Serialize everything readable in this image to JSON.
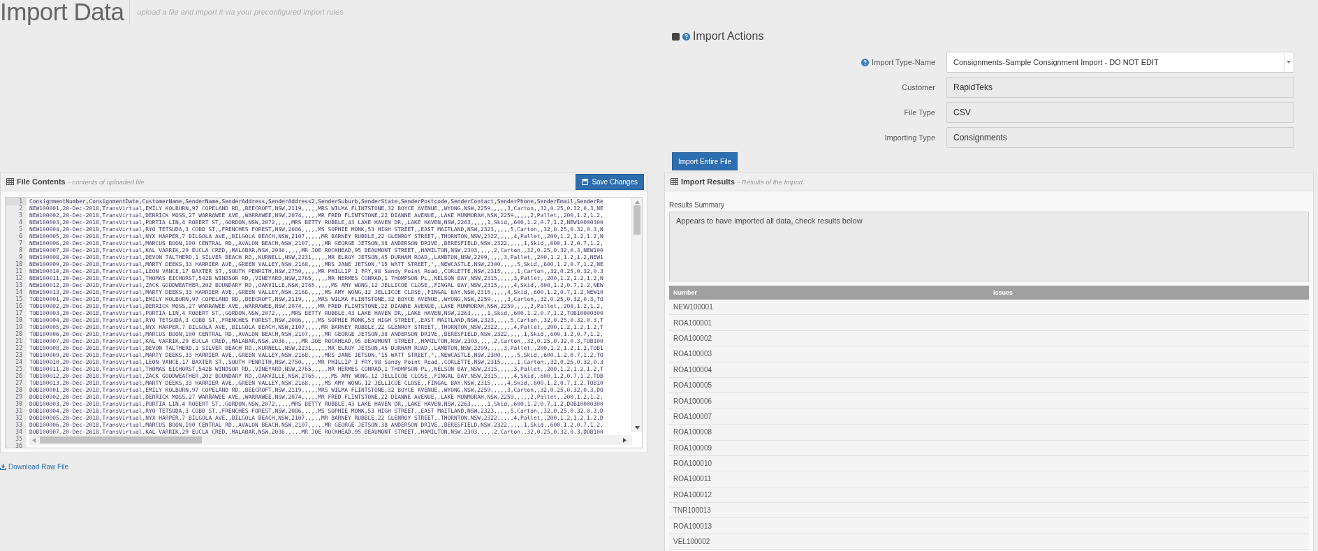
{
  "page": {
    "title": "Import Data",
    "subtitle": "upload a file and import it via your preconfigured import rules"
  },
  "import_actions": {
    "title": "Import Actions",
    "fields": [
      {
        "label": "Import Type-Name",
        "value": "Consignments-Sample Consignment Import - DO NOT EDIT",
        "kind": "select",
        "help": true
      },
      {
        "label": "Customer",
        "value": "RapidTeks",
        "kind": "readonly",
        "help": false
      },
      {
        "label": "File Type",
        "value": "CSV",
        "kind": "readonly",
        "help": false
      },
      {
        "label": "Importing Type",
        "value": "Consignments",
        "kind": "readonly",
        "help": false
      }
    ],
    "button": "Import Entire File"
  },
  "file_contents": {
    "title": "File Contents",
    "subtitle": "- contents of uploaded file",
    "save_button": "Save Changes",
    "lines": [
      {
        "number": "1",
        "text": "ConsignmentNumber,ConsignmentDate,CustomerName,SenderName,SenderAddress,SenderAddress2,SenderSuburb,SenderState,SenderPostcode,SenderContact,SenderPhone,SenderEmail,SenderRe"
      },
      {
        "number": "2",
        "text": "NEW100001,20-Dec-2018,TransVirtual,EMILY KOLBURN,97 COPELAND RD,,BEECROFT,NSW,2119,,,,,MRS WILMA FLINTSTONE,32 BOYCE AVENUE,,WYONG,NSW,2259,,,,,3,Carton,,32,0.25,0.32,0.3,NE"
      },
      {
        "number": "3",
        "text": "NEW100002,20-Dec-2018,TransVirtual,DERRICK MOSS,27 WARRAWEE AVE,,WARRAWEE,NSW,2074,,,,,MR FRED FLINTSTONE,22 DIANNE AVENUE,,LAKE MUNMORAH,NSW,2259,,,,,2,Pallet,,200,1.2,1.2,"
      },
      {
        "number": "4",
        "text": "NEW100003,20-Dec-2018,TransVirtual,PORTIA LIN,4 ROBERT ST,,GORDON,NSW,2072,,,,,MRS BETTY RUBBLE,43 LAKE HAVEN DR,,LAKE HAVEN,NSW,2263,,,,,1,Skid,,600,1.2,0.7,1.2,NEW10000300"
      },
      {
        "number": "5",
        "text": "NEW100004,20-Dec-2018,TransVirtual,RYO TETSUDA,3 COBB ST,,FRENCHES FOREST,NSW,2086,,,,,MS SOPHIE MONK,53 HIGH STREET,,EAST MAITLAND,NSW,2323,,,,,5,Carton,,32,0.25,0.32,0.3,N"
      },
      {
        "number": "6",
        "text": "NEW100005,20-Dec-2018,TransVirtual,NYX HARPER,7 BILGOLA AVE,,BILGOLA BEACH,NSW,2107,,,,,MR BARNEY RUBBLE,22 GLENROY STREET,,THORNTON,NSW,2322,,,,,4,Pallet,,200,1.2,1.2,1.2,N"
      },
      {
        "number": "7",
        "text": "NEW100006,20-Dec-2018,TransVirtual,MARCUS BOON,100 CENTRAL RD,,AVALON BEACH,NSW,2107,,,,,MR GEORGE JETSON,38 ANDERSON DRIVE,,BERESFIELD,NSW,2322,,,,,1,Skid,,600,1.2,0.7,1.2,"
      },
      {
        "number": "8",
        "text": "NEW100007,20-Dec-2018,TransVirtual,KAL VARRIK,29 EUCLA CRED,,MALABAR,NSW,2036,,,,,MR JOE ROCKHEAD,95 BEAUMONT STREET,,HAMILTON,NSW,2303,,,,,2,Carton,,32,0.25,0.32,0.3,NEW100"
      },
      {
        "number": "9",
        "text": "NEW100008,20-Dec-2018,TransVirtual,DEVON TALTHERD,1 SILVER BEACH RD,,KURNELL,NSW,2231,,,,,MR ELROY JETSON,45 DURHAM ROAD,,LAMBTON,NSW,2299,,,,,3,Pallet,,200,1.2,1.2,1.2,NEW1"
      },
      {
        "number": "10",
        "text": "NEW100009,20-Dec-2018,TransVirtual,MARTY DEEKS,33 HARRIER AVE,,GREEN VALLEY,NSW,2168,,,,,MRS JANE JETSON,\"15 WATT STREET,\",,NEWCASTLE,NSW,2300,,,,,5,Skid,,600,1.2,0.7,1.2,NE"
      },
      {
        "number": "11",
        "text": "NEW100010,20-Dec-2018,TransVirtual,LEON VANCE,17 BAXTER ST,,SOUTH PENRITH,NSW,2750,,,,,MR PHILLIP J FRY,98 Sandy Point Road,,CORLETTE,NSW,2315,,,,,1,Carton,,32,0.25,0.32,0.3"
      },
      {
        "number": "12",
        "text": "NEW100011,20-Dec-2018,TransVirtual,THOMAS EICHORST,542B WINDSOR RD,,VINEYARD,NSW,2765,,,,,MR HERMES CONRAD,1 THOMPSON PL,,NELSON BAY,NSW,2315,,,,,3,Pallet,,200,1.2,1.2,1.2,N"
      },
      {
        "number": "13",
        "text": "NEW100012,20-Dec-2018,TransVirtual,ZACK GOODWEATHER,202 BOUNDARY RD,,OAKVILLE,NSW,2765,,,,,MS AMY WONG,12 JELLICOE CLOSE,,FINGAL BAY,NSW,2315,,,,,4,Skid,,600,1.2,0.7,1.2,NEW"
      },
      {
        "number": "14",
        "text": "NEW100013,20-Dec-2018,TransVirtual,MARTY DEEKS,33 HARRIER AVE,,GREEN VALLEY,NSW,2168,,,,,MS AMY WONG,12 JELLICOE CLOSE,,FINGAL BAY,NSW,2315,,,,,4,Skid,,600,1.2,0.7,1.2,NEW10"
      },
      {
        "number": "15",
        "text": "TOB100001,20-Dec-2018,TransVirtual,EMILY KOLBURN,97 COPELAND RD,,BEECROFT,NSW,2119,,,,,MRS WILMA FLINTSTONE,32 BOYCE AVENUE,,WYONG,NSW,2259,,,,,3,Carton,,32,0.25,0.32,0.3,TO"
      },
      {
        "number": "16",
        "text": "TOB100002,20-Dec-2018,TransVirtual,DERRICK MOSS,27 WARRAWEE AVE,,WARRAWEE,NSW,2074,,,,,MR FRED FLINTSTONE,22 DIANNE AVENUE,,LAKE MUNMORAH,NSW,2259,,,,,2,Pallet,,200,1.2,1.2,"
      },
      {
        "number": "17",
        "text": "TOB100003,20-Dec-2018,TransVirtual,PORTIA LIN,4 ROBERT ST,,GORDON,NSW,2072,,,,,MRS BETTY RUBBLE,43 LAKE HAVEN DR,,LAKE HAVEN,NSW,2263,,,,,1,Skid,,600,1.2,0.7,1.2,TOB10000300"
      },
      {
        "number": "18",
        "text": "TOB100004,20-Dec-2018,TransVirtual,RYO TETSUDA,3 COBB ST,,FRENCHES FOREST,NSW,2086,,,,,MS SOPHIE MONK,53 HIGH STREET,,EAST MAITLAND,NSW,2323,,,,,5,Carton,,32,0.25,0.32,0.3,T"
      },
      {
        "number": "19",
        "text": "TOB100005,20-Dec-2018,TransVirtual,NYX HARPER,7 BILGOLA AVE,,BILGOLA BEACH,NSW,2107,,,,,MR BARNEY RUBBLE,22 GLENROY STREET,,THORNTON,NSW,2322,,,,,4,Pallet,,200,1.2,1.2,1.2,T"
      },
      {
        "number": "20",
        "text": "TOB100006,20-Dec-2018,TransVirtual,MARCUS BOON,100 CENTRAL RD,,AVALON BEACH,NSW,2107,,,,,MR GEORGE JETSON,38 ANDERSON DRIVE,,BERESFIELD,NSW,2322,,,,,1,Skid,,600,1.2,0.7,1.2,"
      },
      {
        "number": "21",
        "text": "TOB100007,20-Dec-2018,TransVirtual,KAL VARRIK,29 EUCLA CRED,,MALABAR,NSW,2036,,,,,MR JOE ROCKHEAD,95 BEAUMONT STREET,,HAMILTON,NSW,2303,,,,,2,Carton,,32,0.25,0.32,0.3,TOB100"
      },
      {
        "number": "22",
        "text": "TOB100008,20-Dec-2018,TransVirtual,DEVON TALTHERD,1 SILVER BEACH RD,,KURNELL,NSW,2231,,,,,MR ELROY JETSON,45 DURHAM ROAD,,LAMBTON,NSW,2299,,,,,3,Pallet,,200,1.2,1.2,1.2,TOB1"
      },
      {
        "number": "23",
        "text": "TOB100009,20-Dec-2018,TransVirtual,MARTY DEEKS,33 HARRIER AVE,,GREEN VALLEY,NSW,2168,,,,,MRS JANE JETSON,\"15 WATT STREET,\",,NEWCASTLE,NSW,2300,,,,,5,Skid,,600,1.2,0.7,1.2,TO"
      },
      {
        "number": "24",
        "text": "TOB100010,20-Dec-2018,TransVirtual,LEON VANCE,17 BAXTER ST,,SOUTH PENRITH,NSW,2750,,,,,MR PHILLIP J FRY,98 Sandy Point Road,,CORLETTE,NSW,2315,,,,,1,Carton,,32,0.25,0.32,0.3"
      },
      {
        "number": "25",
        "text": "TOB100011,20-Dec-2018,TransVirtual,THOMAS EICHORST,542B WINDSOR RD,,VINEYARD,NSW,2765,,,,,MR HERMES CONRAD,1 THOMPSON PL,,NELSON BAY,NSW,2315,,,,,3,Pallet,,200,1.2,1.2,1.2,T"
      },
      {
        "number": "26",
        "text": "TOB100012,20-Dec-2018,TransVirtual,ZACK GOODWEATHER,202 BOUNDARY RD,,OAKVILLE,NSW,2765,,,,,MS AMY WONG,12 JELLICOE CLOSE,,FINGAL BAY,NSW,2315,,,,,4,Skid,,600,1.2,0.7,1.2,TOB"
      },
      {
        "number": "27",
        "text": "TOB100013,20-Dec-2018,TransVirtual,MARTY DEEKS,33 HARRIER AVE,,GREEN VALLEY,NSW,2168,,,,,MS AMY WONG,12 JELLICOE CLOSE,,FINGAL BAY,NSW,2315,,,,,4,Skid,,600,1.2,0.7,1.2,TOB10"
      },
      {
        "number": "28",
        "text": "DOB100001,20-Dec-2018,TransVirtual,EMILY KOLBURN,97 COPELAND RD,,BEECROFT,NSW,2119,,,,,MRS WILMA FLINTSTONE,32 BOYCE AVENUE,,WYONG,NSW,2259,,,,,3,Carton,,32,0.25,0.32,0.3,DO"
      },
      {
        "number": "29",
        "text": "DOB100002,20-Dec-2018,TransVirtual,DERRICK MOSS,27 WARRAWEE AVE,,WARRAWEE,NSW,2074,,,,,MR FRED FLINTSTONE,22 DIANNE AVENUE,,LAKE MUNMORAH,NSW,2259,,,,,2,Pallet,,200,1.2,1.2,"
      },
      {
        "number": "30",
        "text": "DOB100003,20-Dec-2018,TransVirtual,PORTIA LIN,4 ROBERT ST,,GORDON,NSW,2072,,,,,MRS BETTY RUBBLE,43 LAKE HAVEN DR,,LAKE HAVEN,NSW,2263,,,,,1,Skid,,600,1.2,0.7,1.2,DOB10000300"
      },
      {
        "number": "31",
        "text": "DOB100004,20-Dec-2018,TransVirtual,RYO TETSUDA,3 COBB ST,,FRENCHES FOREST,NSW,2086,,,,,MS SOPHIE MONK,53 HIGH STREET,,EAST MAITLAND,NSW,2323,,,,,5,Carton,,32,0.25,0.32,0.3,D"
      },
      {
        "number": "32",
        "text": "DOB100005,20-Dec-2018,TransVirtual,NYX HARPER,7 BILGOLA AVE,,BILGOLA BEACH,NSW,2107,,,,,MR BARNEY RUBBLE,22 GLENROY STREET,,THORNTON,NSW,2322,,,,,4,Pallet,,200,1.2,1.2,1.2,D"
      },
      {
        "number": "33",
        "text": "DOB100006,20-Dec-2018,TransVirtual,MARCUS BOON,100 CENTRAL RD,,AVALON BEACH,NSW,2107,,,,,MR GEORGE JETSON,38 ANDERSON DRIVE,,BERESFIELD,NSW,2322,,,,,1,Skid,,600,1.2,0.7,1.2,"
      },
      {
        "number": "34",
        "text": "DOB100007,20-Dec-2018,TransVirtual,KAL VARRIK,29 EUCLA CRED,,MALABAR,NSW,2036,,,,,MR JOE ROCKHEAD,95 BEAUMONT STREET,,HAMILTON,NSW,2303,,,,,2,Carton,,32,0.25,0.32,0.3,DOB100"
      },
      {
        "number": "35"
      },
      {
        "number": "36"
      }
    ],
    "download_link": "Download Raw File"
  },
  "import_results": {
    "title": "Import Results",
    "subtitle": "- Results of the Import",
    "summary_label": "Results Summary",
    "summary": "Appears to have imported all data, check results below",
    "columns": [
      "Number",
      "Issues"
    ],
    "rows": [
      {
        "number": "NEW100001"
      },
      {
        "number": "ROA100001"
      },
      {
        "number": "ROA100002"
      },
      {
        "number": "ROA100003"
      },
      {
        "number": "ROA100004"
      },
      {
        "number": "ROA100005"
      },
      {
        "number": "ROA100006"
      },
      {
        "number": "ROA100007"
      },
      {
        "number": "ROA100008"
      },
      {
        "number": "ROA100009"
      },
      {
        "number": "ROA100010"
      },
      {
        "number": "ROA100011"
      },
      {
        "number": "ROA100012"
      },
      {
        "number": "TNR100013"
      },
      {
        "number": "ROA100013"
      },
      {
        "number": "VEL100002"
      }
    ]
  }
}
